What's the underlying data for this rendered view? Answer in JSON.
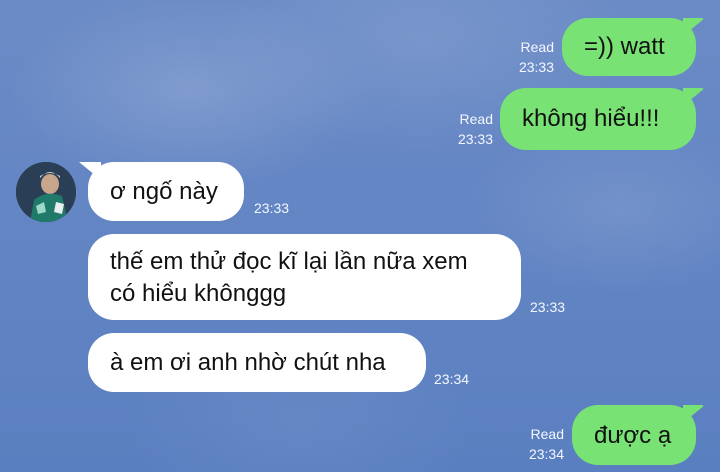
{
  "messages": [
    {
      "direction": "out",
      "text": "=)) watt",
      "status": "Read",
      "time": "23:33"
    },
    {
      "direction": "out",
      "text": "không hiểu!!!",
      "status": "Read",
      "time": "23:33"
    },
    {
      "direction": "in",
      "text": "ơ ngố này",
      "time": "23:33"
    },
    {
      "direction": "in",
      "text_lines": [
        "thế em thử đọc kĩ lại lần nữa xem",
        "có hiểu khônggg"
      ],
      "time": "23:33"
    },
    {
      "direction": "in",
      "text": "à em ơi anh nhờ chút nha",
      "time": "23:34"
    },
    {
      "direction": "out",
      "text": "được ạ",
      "status": "Read",
      "time": "23:34"
    }
  ],
  "colors": {
    "background": "#6486c4",
    "outgoing_bubble": "#79e274",
    "incoming_bubble": "#ffffff",
    "meta_text": "#f4f7ff"
  },
  "icons": {
    "contact_avatar": "avatar-photo"
  }
}
